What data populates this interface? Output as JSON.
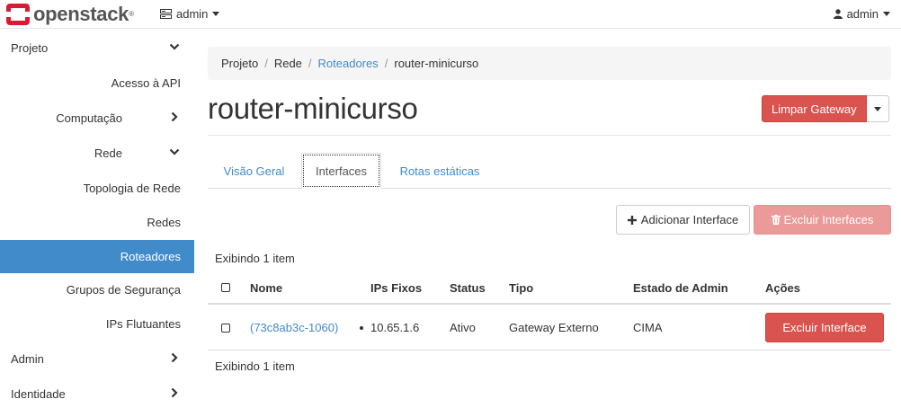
{
  "navbar": {
    "logo_text": "openstack",
    "logo_mark": "®",
    "project_menu_label": "admin",
    "user_menu_label": "admin",
    "brand_color": "#da1a32"
  },
  "sidebar": {
    "items": [
      {
        "label": "Projeto",
        "level": "top",
        "chevron": "down"
      },
      {
        "label": "Acesso à API",
        "level": "leaf"
      },
      {
        "label": "Computação",
        "level": "mid",
        "chevron": "right"
      },
      {
        "label": "Rede",
        "level": "mid",
        "chevron": "down"
      },
      {
        "label": "Topologia de Rede",
        "level": "leaf"
      },
      {
        "label": "Redes",
        "level": "leaf"
      },
      {
        "label": "Roteadores",
        "level": "leaf",
        "active": true
      },
      {
        "label": "Grupos de Segurança",
        "level": "leaf"
      },
      {
        "label": "IPs Flutuantes",
        "level": "leaf"
      },
      {
        "label": "Admin",
        "level": "top",
        "chevron": "right"
      },
      {
        "label": "Identidade",
        "level": "top",
        "chevron": "right"
      }
    ],
    "active_color": "#428bca"
  },
  "breadcrumb": {
    "items": [
      "Projeto",
      "Rede",
      "Roteadores",
      "router-minicurso"
    ],
    "separator": "/"
  },
  "page": {
    "title": "router-minicurso",
    "clear_gateway_label": "Limpar Gateway"
  },
  "tabs": [
    "Visão Geral",
    "Interfaces",
    "Rotas estáticas"
  ],
  "active_tab": "Interfaces",
  "actions": {
    "add_interface_label": "Adicionar Interface",
    "delete_interfaces_label": "Excluir Interfaces"
  },
  "table": {
    "count_top": "Exibindo 1 item",
    "count_bottom": "Exibindo 1 item",
    "columns": [
      "Nome",
      "IPs Fixos",
      "Status",
      "Tipo",
      "Estado de Admin",
      "Ações"
    ],
    "rows": [
      {
        "name": "(73c8ab3c-1060)",
        "fixed_ip": "10.65.1.6",
        "status": "Ativo",
        "type": "Gateway Externo",
        "admin_state": "CIMA",
        "action_label": "Excluir Interface"
      }
    ]
  },
  "colors": {
    "danger": "#d9534f",
    "danger_disabled": "#ea9a98",
    "link": "#428bca"
  }
}
